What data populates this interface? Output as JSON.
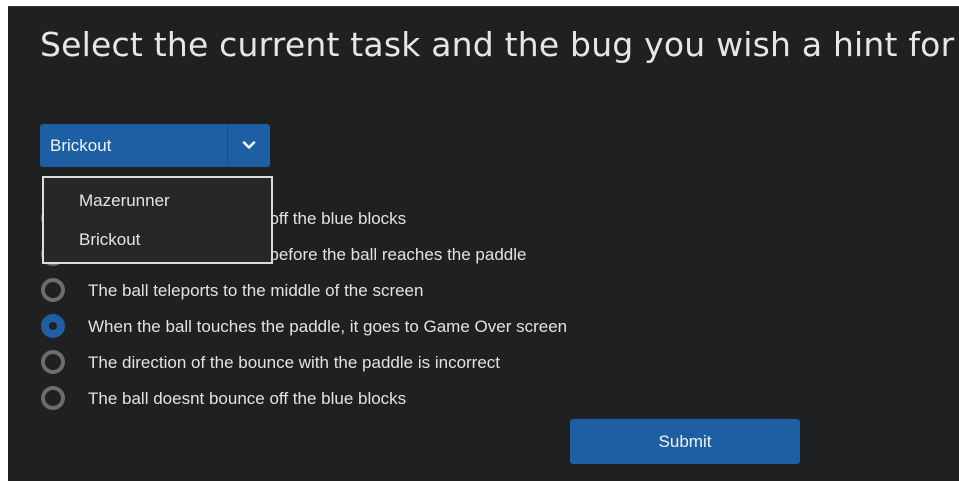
{
  "page": {
    "title": "Select the current task and the bug you wish a hint for"
  },
  "task_select": {
    "selected": "Brickout",
    "icon": "chevron-down-icon",
    "options": [
      "Mazerunner",
      "Brickout"
    ],
    "open": true
  },
  "bug_options": [
    {
      "label": "The ball doesnt bounce off the blue blocks",
      "selected": false
    },
    {
      "label": "Game Over is triggered before the ball reaches the paddle",
      "selected": false
    },
    {
      "label": "The ball teleports to the middle of the screen",
      "selected": false
    },
    {
      "label": "When the ball touches the paddle, it goes to Game Over screen",
      "selected": true
    },
    {
      "label": "The direction of the bounce with the paddle is incorrect",
      "selected": false
    },
    {
      "label": "The ball doesnt bounce off the blue blocks",
      "selected": false
    }
  ],
  "submit": {
    "label": "Submit"
  },
  "colors": {
    "background": "#1f2021",
    "accent": "#1e5fa3",
    "radio_border": "#6d6d6d",
    "text": "#e2e2e2"
  }
}
